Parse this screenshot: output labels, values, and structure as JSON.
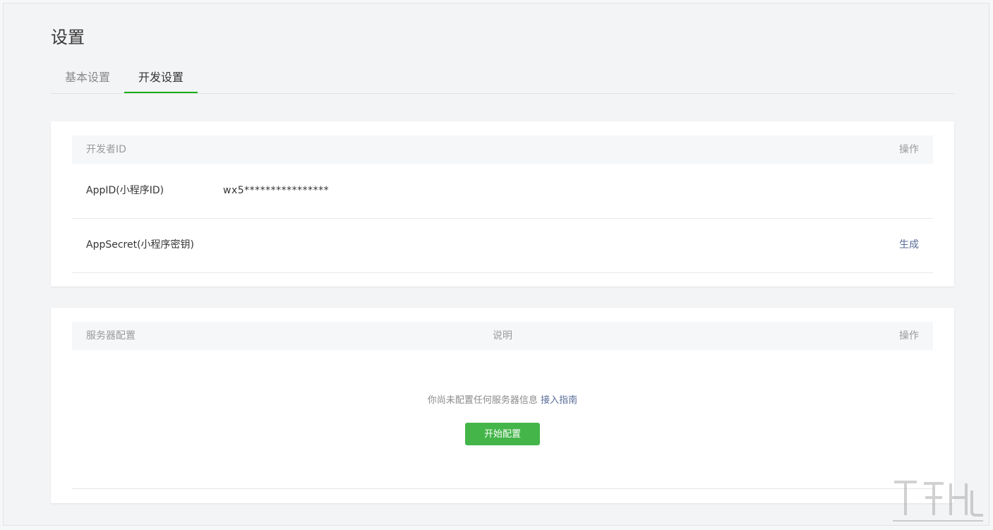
{
  "page": {
    "title": "设置"
  },
  "tabs": [
    {
      "label": "基本设置",
      "active": false
    },
    {
      "label": "开发设置",
      "active": true
    }
  ],
  "developer_id": {
    "headers": {
      "left": "开发者ID",
      "right": "操作"
    },
    "rows": [
      {
        "label": "AppID(小程序ID)",
        "value": "wx5****************",
        "action": ""
      },
      {
        "label": "AppSecret(小程序密钥)",
        "value": "",
        "action": "生成"
      }
    ]
  },
  "server_config": {
    "headers": {
      "left": "服务器配置",
      "center": "说明",
      "right": "操作"
    },
    "empty_message": "你尚未配置任何服务器信息",
    "guide_link": "接入指南",
    "start_button": "开始配置"
  },
  "colors": {
    "accent_green": "#1aad19",
    "button_green": "#44b549",
    "link_blue": "#576b95"
  }
}
